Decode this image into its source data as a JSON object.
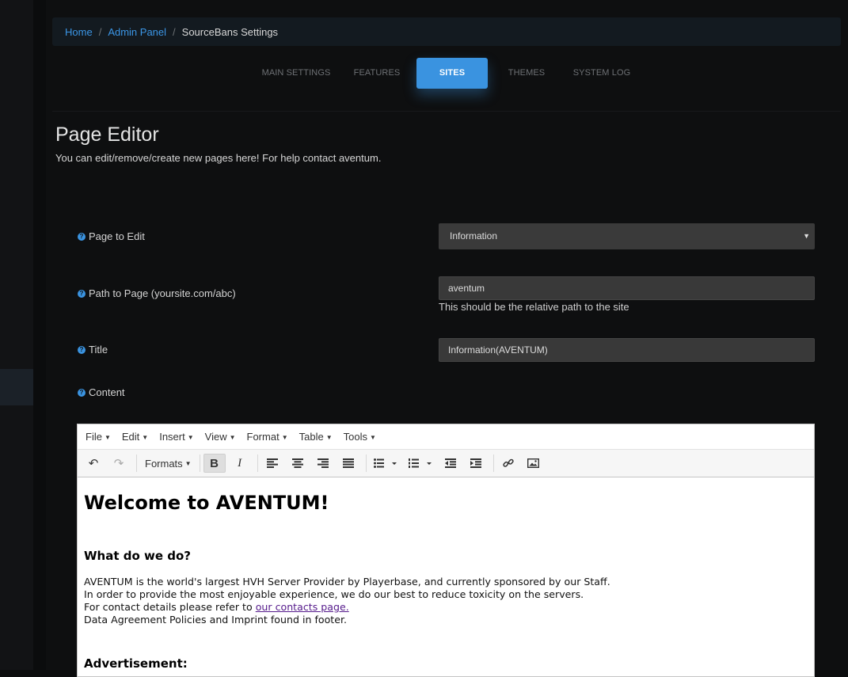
{
  "breadcrumb": {
    "home": "Home",
    "admin": "Admin Panel",
    "current": "SourceBans Settings"
  },
  "tabs": [
    {
      "label": "MAIN SETTINGS",
      "active": false
    },
    {
      "label": "FEATURES",
      "active": false
    },
    {
      "label": "SITES",
      "active": true
    },
    {
      "label": "THEMES",
      "active": false
    },
    {
      "label": "SYSTEM LOG",
      "active": false
    }
  ],
  "page": {
    "title": "Page Editor",
    "description": "You can edit/remove/create new pages here! For help contact aventum."
  },
  "form": {
    "page_to_edit": {
      "label": "Page to Edit",
      "value": "Information"
    },
    "path": {
      "label": "Path to Page (yoursite.com/abc)",
      "value": "aventum",
      "help": "This should be the relative path to the site"
    },
    "title": {
      "label": "Title",
      "value": "Information(AVENTUM)"
    },
    "content": {
      "label": "Content"
    }
  },
  "editor": {
    "menu": [
      "File",
      "Edit",
      "Insert",
      "View",
      "Format",
      "Table",
      "Tools"
    ],
    "toolbar": {
      "formats": "Formats"
    },
    "content": {
      "heading": "Welcome to AVENTUM!",
      "subheading": "What do we do?",
      "line1": "AVENTUM is the world's largest HVH Server Provider by Playerbase, and currently sponsored by our Staff.",
      "line2": "In order to provide the most enjoyable experience, we do our best to reduce toxicity on the servers.",
      "line3_prefix": "For contact details please refer to ",
      "line3_link": "our contacts page.",
      "line4": "Data Agreement Policies and Imprint found in footer.",
      "subheading2": "Advertisement:"
    }
  },
  "colors": {
    "accent": "#3a93e0",
    "background": "#0b0c0d",
    "link": "#3b96e6"
  }
}
